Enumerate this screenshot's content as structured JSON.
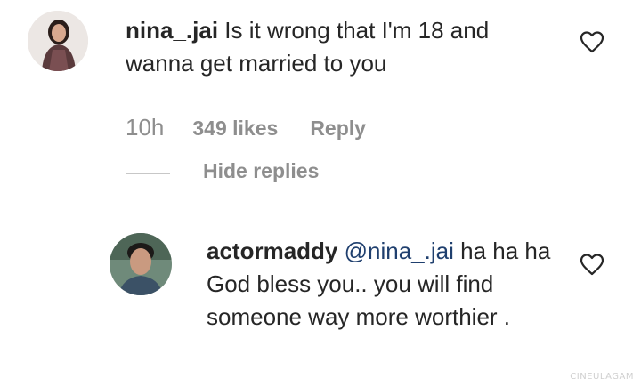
{
  "comment": {
    "username": "nina_.jai",
    "text": "Is it wrong that I'm 18 and wanna get married to you",
    "time": "10h",
    "likes": "349 likes",
    "reply_label": "Reply",
    "hide_replies_label": "Hide replies"
  },
  "reply": {
    "username": "actormaddy",
    "mention": "@nina_.jai",
    "text": "ha ha ha God bless you.. you will find someone way more worthier ."
  },
  "watermark": "CINEULAGAM",
  "icons": {
    "like": "heart-outline-icon"
  }
}
